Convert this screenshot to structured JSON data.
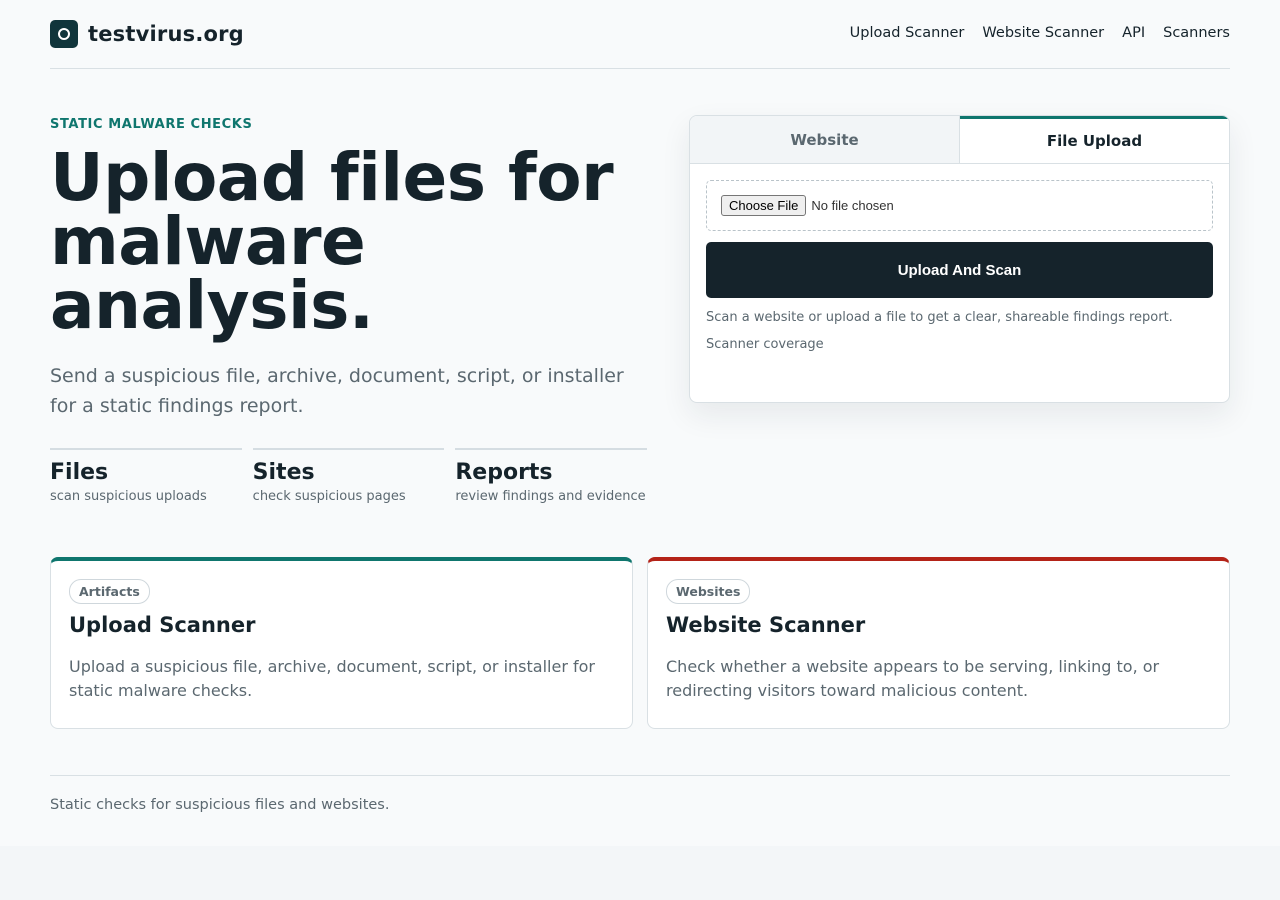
{
  "brand": {
    "name": "testvirus.org",
    "icon": "logo-ring-icon"
  },
  "nav": {
    "items": [
      "Upload Scanner",
      "Website Scanner",
      "API",
      "Scanners"
    ]
  },
  "hero": {
    "eyebrow": "STATIC MALWARE CHECKS",
    "title": "Upload files for malware analysis.",
    "subtitle": "Send a suspicious file, archive, document, script, or installer for a static findings report.",
    "stats": [
      {
        "title": "Files",
        "desc": "scan suspicious uploads"
      },
      {
        "title": "Sites",
        "desc": "check suspicious pages"
      },
      {
        "title": "Reports",
        "desc": "review findings and evidence"
      }
    ]
  },
  "panel": {
    "tabs": [
      {
        "label": "Website",
        "active": false
      },
      {
        "label": "File Upload",
        "active": true
      }
    ],
    "file_input": {
      "button_label": "Choose File",
      "status": "No file chosen"
    },
    "submit_label": "Upload And Scan",
    "note": "Scan a website or upload a file to get a clear, shareable findings report.",
    "coverage_link": "Scanner coverage"
  },
  "cards": [
    {
      "badge": "Artifacts",
      "title": "Upload Scanner",
      "desc": "Upload a suspicious file, archive, document, script, or installer for static malware checks.",
      "accent": "#0f766e"
    },
    {
      "badge": "Websites",
      "title": "Website Scanner",
      "desc": "Check whether a website appears to be serving, linking to, or redirecting visitors toward malicious content.",
      "accent": "#b42318"
    }
  ],
  "footer": {
    "text": "Static checks for suspicious files and websites."
  },
  "colors": {
    "accent": "#0f766e",
    "danger": "#b42318",
    "ink": "#15232b",
    "muted": "#5b6870"
  }
}
